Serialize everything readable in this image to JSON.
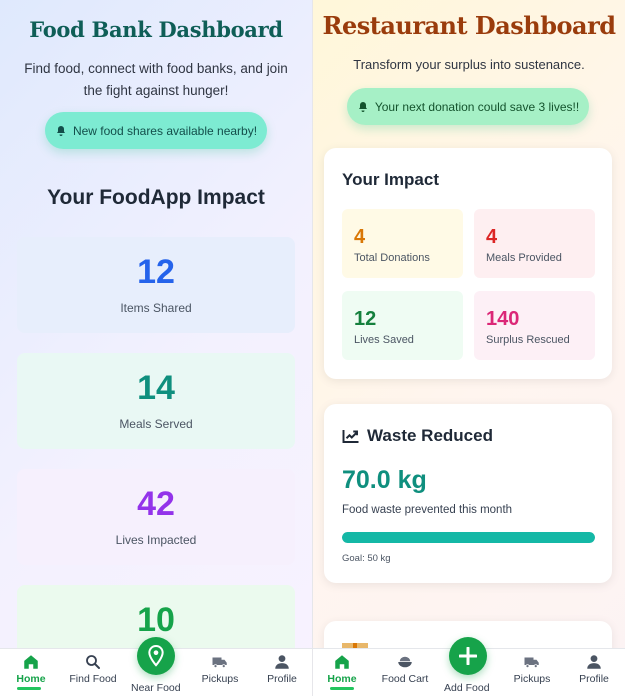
{
  "left": {
    "title": "Food Bank Dashboard",
    "subtitle": "Find food, connect with food banks, and join the fight against hunger!",
    "notice": "New food shares available nearby!",
    "impact_heading": "Your FoodApp Impact",
    "stats": [
      {
        "value": "12",
        "label": "Items Shared"
      },
      {
        "value": "14",
        "label": "Meals Served"
      },
      {
        "value": "42",
        "label": "Lives Impacted"
      },
      {
        "value": "10",
        "label": ""
      }
    ],
    "nav": {
      "home": "Home",
      "find_food": "Find Food",
      "near_food": "Near Food",
      "pickups": "Pickups",
      "profile": "Profile"
    }
  },
  "right": {
    "title": "Restaurant Dashboard",
    "subtitle": "Transform your surplus into sustenance.",
    "notice": "Your next donation could save 3 lives!!",
    "impact": {
      "heading": "Your Impact",
      "tiles": [
        {
          "value": "4",
          "label": "Total Donations"
        },
        {
          "value": "4",
          "label": "Meals Provided"
        },
        {
          "value": "12",
          "label": "Lives Saved"
        },
        {
          "value": "140",
          "label": "Surplus Rescued"
        }
      ]
    },
    "waste": {
      "heading": "Waste Reduced",
      "value": "70.0 kg",
      "description": "Food waste prevented this month",
      "goal": "Goal: 50 kg",
      "progress_fraction": 1.0
    },
    "nav": {
      "home": "Home",
      "food_cart": "Food Cart",
      "add_food": "Add Food",
      "pickups": "Pickups",
      "profile": "Profile"
    }
  },
  "colors": {
    "accent_green": "#16a34a",
    "teal": "#0f8f7e",
    "restaurant_title": "#9a3c0c",
    "foodbank_title": "#0f5e57"
  }
}
